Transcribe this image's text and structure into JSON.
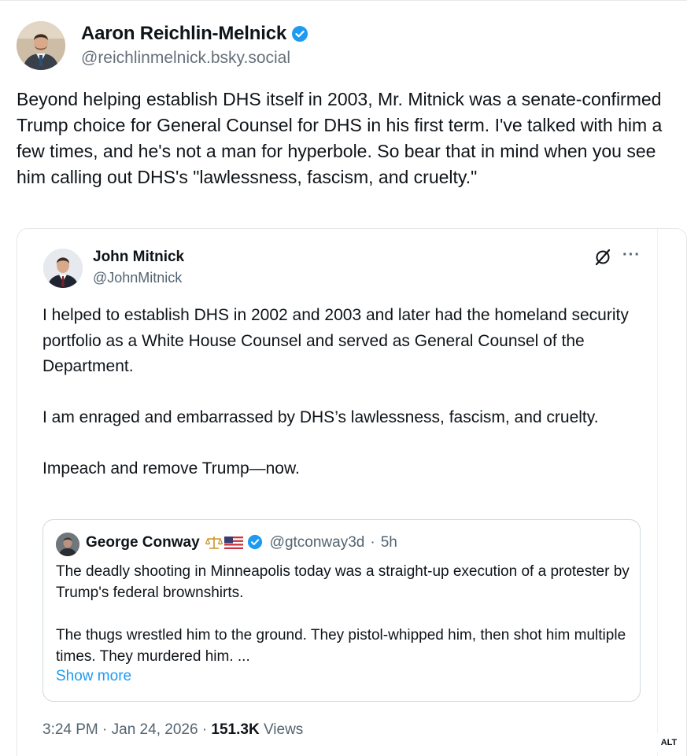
{
  "post": {
    "author_name": "Aaron Reichlin-Melnick",
    "author_handle": "@reichlinmelnick.bsky.social",
    "text": "Beyond helping establish DHS itself in 2003, Mr. Mitnick was a senate-confirmed Trump choice for General Counsel for DHS in his first term. I've talked with him a few times, and he's not a man for hyperbole. So bear that in mind when you see him calling out DHS's \"lawlessness, fascism, and cruelty.\""
  },
  "embed": {
    "author_name": "John Mitnick",
    "author_handle": "@JohnMitnick",
    "paragraphs": [
      "I helped to establish DHS in 2002 and 2003 and later had the homeland security portfolio as a White House Counsel and served as General Counsel of the Department.",
      "I am enraged and embarrassed by DHS’s lawlessness, fascism, and cruelty.",
      "Impeach and remove Trump—now."
    ],
    "quote": {
      "author_name": "George Conway",
      "author_handle": "@gtconway3d",
      "separator": "·",
      "age": "5h",
      "paragraphs": [
        "The deadly shooting in Minneapolis today was a straight-up execution of a protester by Trump's federal brownshirts.",
        "The thugs wrestled him to the ground.  They pistol-whipped him, then shot him multiple times.  They murdered him.  ..."
      ],
      "show_more": "Show more"
    },
    "timestamp": "3:24 PM · Jan 24, 2026 · ",
    "views_count": "151.3K",
    "views_label": " Views"
  },
  "alt_badge": "ALT",
  "colors": {
    "verified": "#1d9bf0",
    "link": "#1d9bf0",
    "secondary_text": "#536471"
  },
  "icons": {
    "verified": "verified-badge-icon",
    "grok": "grok-icon",
    "more": "more-options-icon",
    "scales": "scales-emoji-icon",
    "flag": "us-flag-emoji-icon"
  }
}
